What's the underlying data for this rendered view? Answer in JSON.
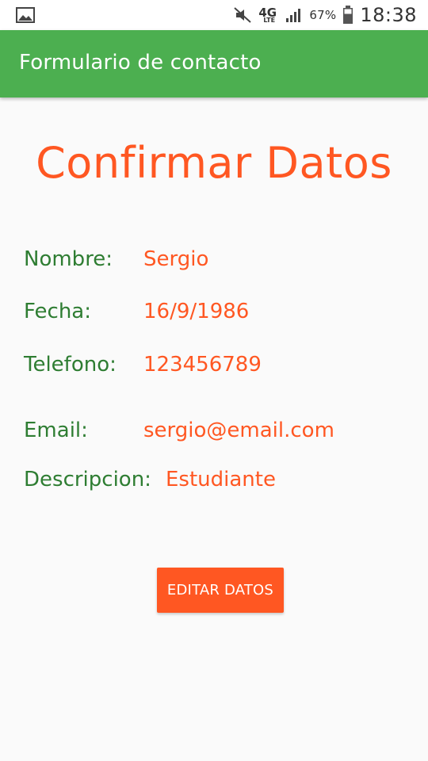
{
  "status_bar": {
    "battery_percent": "67%",
    "time": "18:38",
    "network": "4G",
    "network_sub": "LTE",
    "icons": [
      "gallery-icon",
      "mute-icon",
      "lte-icon",
      "signal-icon",
      "battery-icon"
    ]
  },
  "app_bar": {
    "title": "Formulario de contacto",
    "color": "#4caf50"
  },
  "page": {
    "title": "Confirmar Datos"
  },
  "fields": [
    {
      "label": "Nombre:",
      "value": "Sergio"
    },
    {
      "label": "Fecha:",
      "value": "16/9/1986"
    },
    {
      "label": "Telefono:",
      "value": "123456789"
    },
    {
      "label": "Email:",
      "value": "sergio@email.com"
    },
    {
      "label": "Descripcion:",
      "value": "Estudiante"
    }
  ],
  "actions": {
    "edit_label": "EDITAR DATOS"
  },
  "colors": {
    "accent": "#ff5722",
    "label_green": "#2e7d32",
    "background": "#fafafa"
  }
}
